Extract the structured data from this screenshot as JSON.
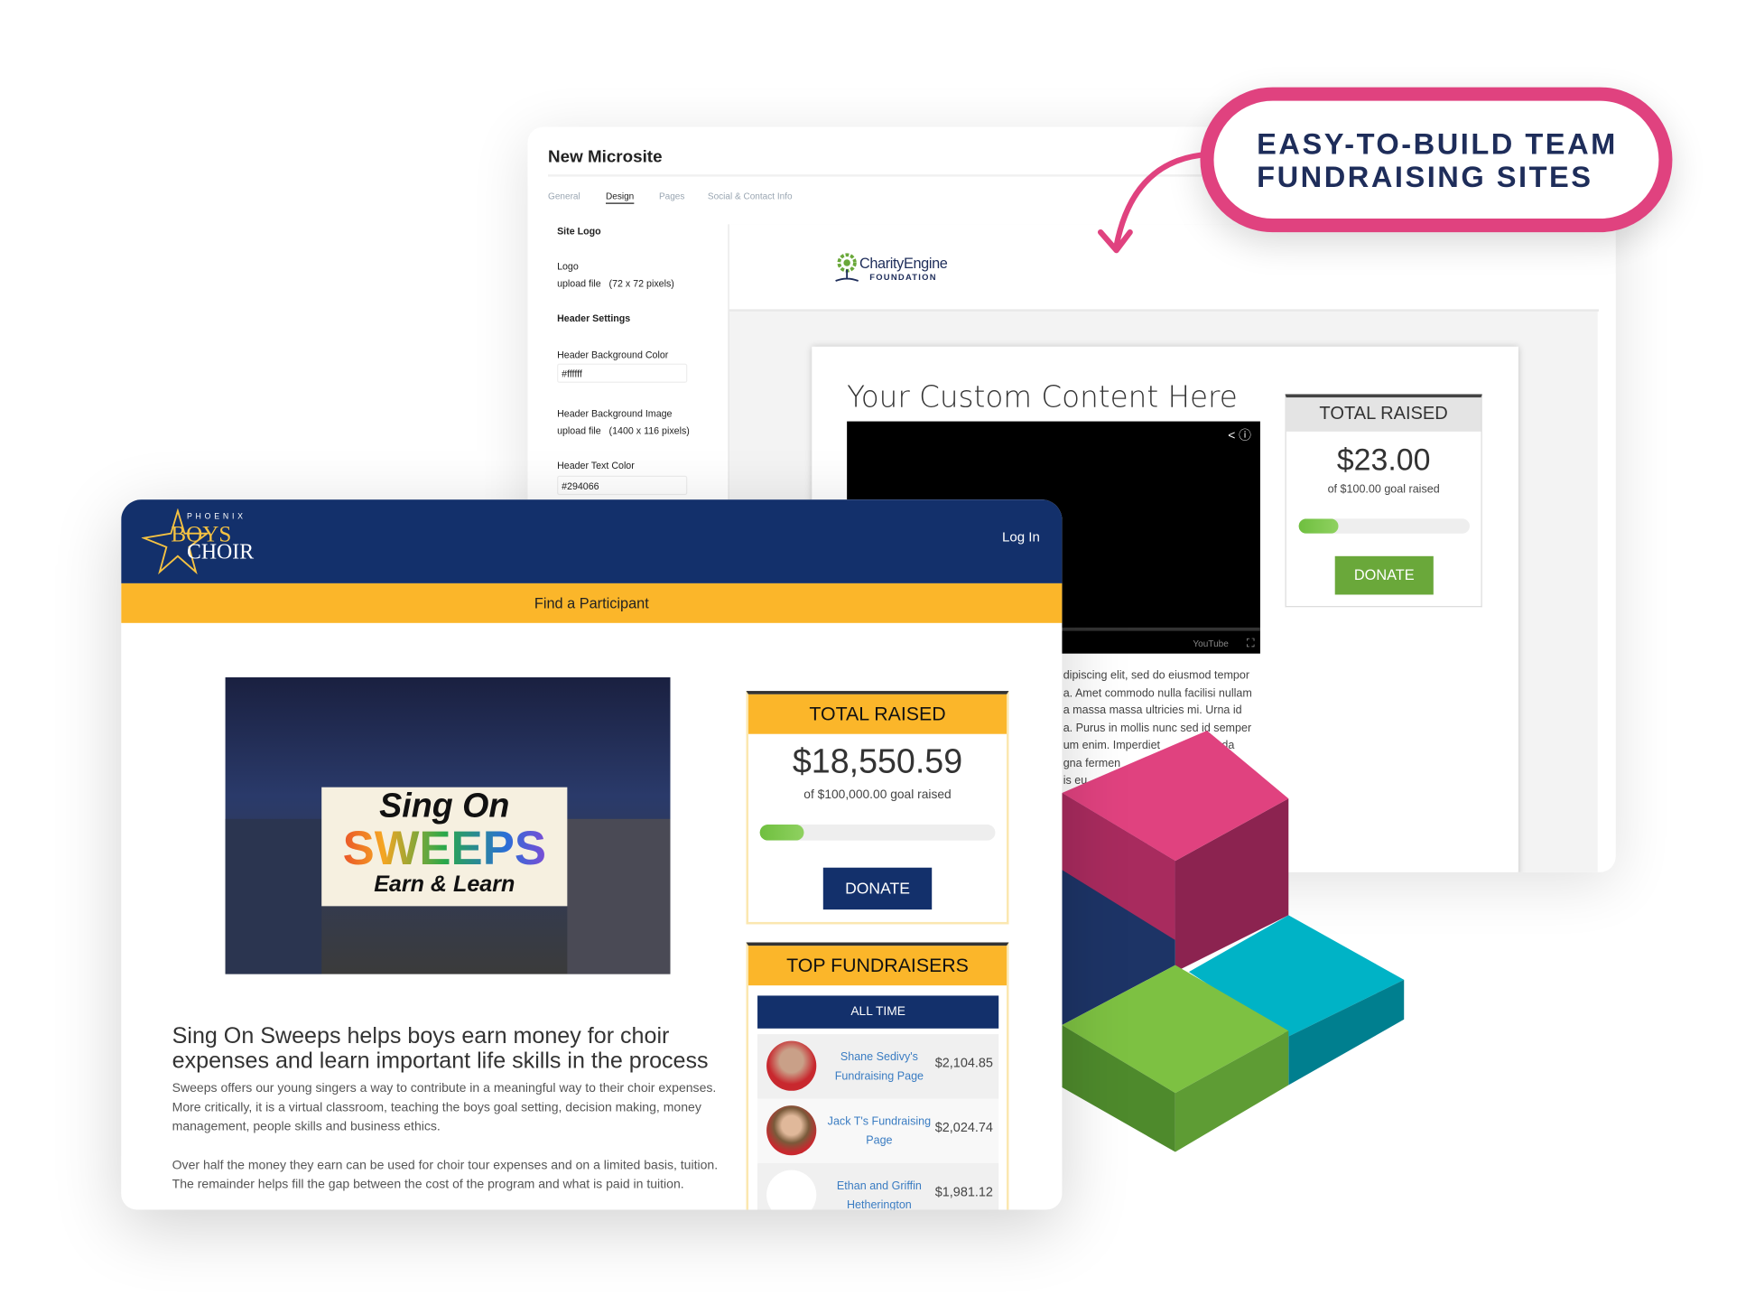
{
  "callout": {
    "line1": "EASY-TO-BUILD TEAM",
    "line2": "FUNDRAISING SITES"
  },
  "colors": {
    "pink": "#e0427f",
    "navy": "#13306b",
    "yellow": "#fbb62a",
    "green": "#6aa83a",
    "teal": "#00b3c6"
  },
  "builder": {
    "title": "New Microsite",
    "tabs": [
      {
        "label": "General"
      },
      {
        "label": "Design",
        "active": true
      },
      {
        "label": "Pages"
      },
      {
        "label": "Social & Contact Info"
      }
    ],
    "site_logo": "Site Logo",
    "logo_label": "Logo",
    "logo_upload": "upload file   (72 x 72 pixels)",
    "header_settings": "Header Settings",
    "header_bg_color_label": "Header Background Color",
    "header_bg_color_value": "#ffffff",
    "header_bg_image_label": "Header Background Image",
    "header_bg_image_upload": "upload file   (1400 x 116 pixels)",
    "header_text_color_label": "Header Text Color",
    "header_text_color_value": "#294066"
  },
  "preview": {
    "logo_name": "CharityEngine",
    "logo_sub": "FOUNDATION",
    "custom_heading": "Your Custom Content Here",
    "video_brand": "YouTube",
    "lorem": "dipiscing elit, sed do eiusmod tempor\na. Amet commodo nulla facilisi nullam\na massa massa ultricies mi. Urna id\na. Purus in mollis nunc sed id semper\num enim. Imperdiet      malesuada\ngna fermen            turpis\nis eu",
    "total_raised": {
      "title": "TOTAL RAISED",
      "amount": "$23.00",
      "goal": "of $100.00 goal raised",
      "progress": 0.23,
      "donate": "DONATE"
    }
  },
  "microsite": {
    "logo": {
      "top": "PHOENIX",
      "main1": "BOYS",
      "main2": "CHOIR"
    },
    "login": "Log In",
    "find": "Find a Participant",
    "collage": {
      "l1": "Sing On",
      "l2": "SWEEPS",
      "l3": "Earn & Learn"
    },
    "heading": "Sing On Sweeps helps boys earn money for choir expenses and learn important life skills in the process",
    "para1": "Sweeps offers our young singers a way to contribute in a meaningful way to their choir expenses. More critically, it is a virtual classroom, teaching the boys goal setting, decision making, money management, people skills and business ethics.",
    "para2": "Over half the money they earn can be used for choir tour expenses and on a limited basis, tuition. The remainder helps fill the gap between the cost of the program and what is paid in tuition.",
    "total_raised": {
      "title": "TOTAL RAISED",
      "amount": "$18,550.59",
      "goal": "of $100,000.00 goal raised",
      "progress": 0.1855,
      "donate": "DONATE"
    },
    "top_fundraisers": {
      "title": "TOP FUNDRAISERS",
      "tab": "ALL TIME",
      "rows": [
        {
          "name": "Shane Sedivy's Fundraising Page",
          "amount": "$2,104.85"
        },
        {
          "name": "Jack T's Fundraising Page",
          "amount": "$2,024.74"
        },
        {
          "name": "Ethan and Griffin Hetherington",
          "amount": "$1,981.12"
        }
      ]
    }
  }
}
